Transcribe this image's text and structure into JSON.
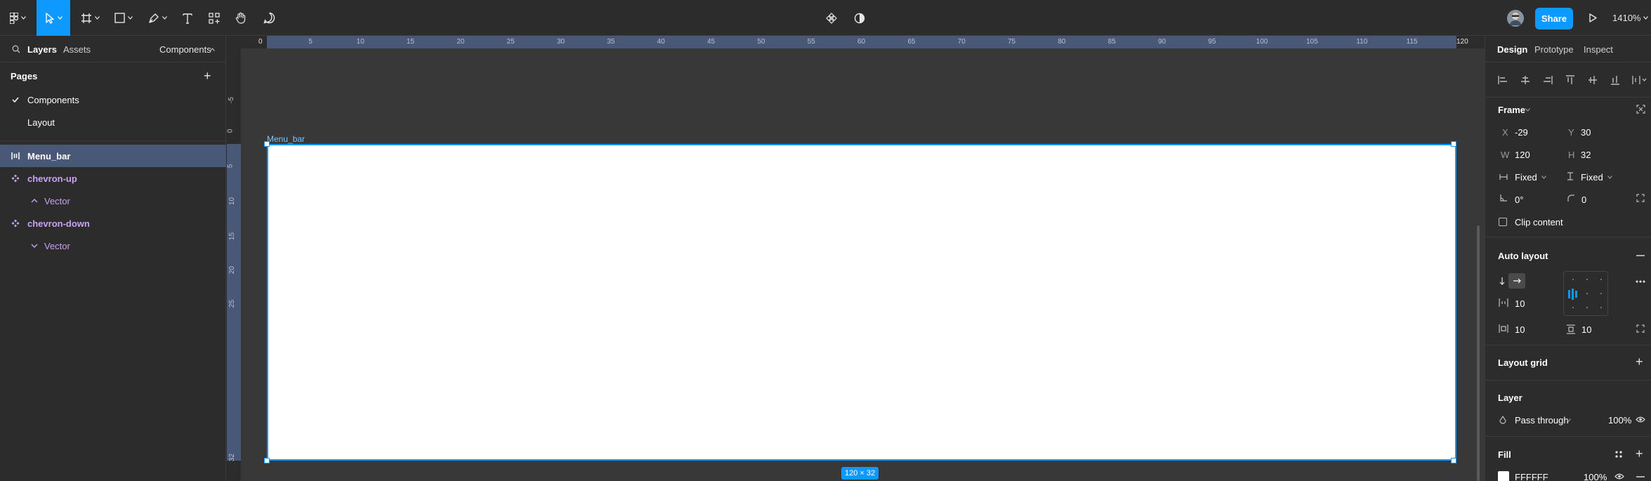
{
  "toolbar": {
    "tools": [
      "main-menu",
      "move-tool",
      "frame-tool",
      "shape-tool",
      "pen-tool",
      "text-tool",
      "resources-tool",
      "hand-tool",
      "comment-tool"
    ],
    "share_label": "Share",
    "zoom": "1410%"
  },
  "left_panel": {
    "tabs": {
      "layers": "Layers",
      "assets": "Assets",
      "components": "Components"
    },
    "pages_title": "Pages",
    "pages": [
      "Components",
      "Layout"
    ],
    "layers": [
      {
        "name": "Menu_bar",
        "type": "frame"
      },
      {
        "name": "chevron-up",
        "type": "component"
      },
      {
        "name": "Vector",
        "type": "vector"
      },
      {
        "name": "chevron-down",
        "type": "component"
      },
      {
        "name": "Vector",
        "type": "vector"
      }
    ]
  },
  "canvas": {
    "ruler_top": [
      "0",
      "5",
      "10",
      "15",
      "20",
      "25",
      "30",
      "35",
      "40",
      "45",
      "50",
      "55",
      "60",
      "65",
      "70",
      "75",
      "80",
      "85",
      "90",
      "95",
      "100",
      "105",
      "110",
      "115",
      "120"
    ],
    "ruler_left": [
      "-5",
      "0",
      "5",
      "10",
      "15",
      "20",
      "25",
      "32"
    ],
    "frame_name": "Menu_bar",
    "size_badge": "120 × 32"
  },
  "right_panel": {
    "tabs": {
      "design": "Design",
      "prototype": "Prototype",
      "inspect": "Inspect"
    },
    "frame": {
      "title": "Frame",
      "x_label": "X",
      "x": "-29",
      "y_label": "Y",
      "y": "30",
      "w_label": "W",
      "w": "120",
      "h_label": "H",
      "h": "32",
      "h_sizing": "Fixed",
      "v_sizing": "Fixed",
      "rotation": "0°",
      "radius": "0",
      "clip_content": "Clip content"
    },
    "auto_layout": {
      "title": "Auto layout",
      "spacing": "10",
      "padding_h": "10",
      "padding_v": "10"
    },
    "layout_grid": {
      "title": "Layout grid"
    },
    "layer": {
      "title": "Layer",
      "blend": "Pass through",
      "opacity": "100%"
    },
    "fill": {
      "title": "Fill",
      "hex": "FFFFFF",
      "opacity": "100%"
    }
  },
  "colors": {
    "accent": "#0d99ff",
    "selection": "#4a5878",
    "component": "#c9a2f5",
    "canvas": "#383838",
    "panel": "#2c2c2c"
  }
}
